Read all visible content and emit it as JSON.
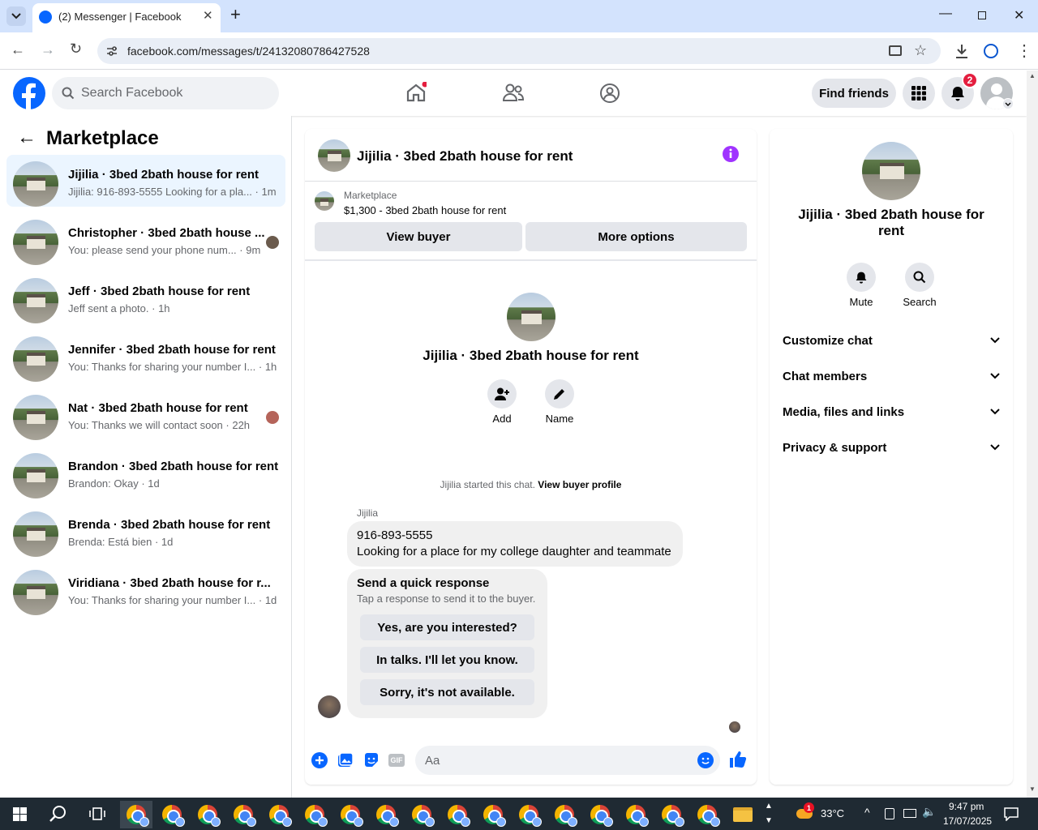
{
  "browser": {
    "tab_title": "(2) Messenger | Facebook",
    "url": "facebook.com/messages/t/24132080786427528"
  },
  "fb_header": {
    "search_placeholder": "Search Facebook",
    "find_friends": "Find friends",
    "notification_count": "2",
    "brand_color": "#0866ff"
  },
  "left_panel": {
    "title": "Marketplace",
    "conversations": [
      {
        "name": "Jijilia · 3bed 2bath house for rent",
        "preview": "Jijilia: 916-893-5555 Looking for a pla...",
        "time": "1m",
        "active": true
      },
      {
        "name": "Christopher · 3bed 2bath house ...",
        "preview": "You: please send your phone num...",
        "time": "9m"
      },
      {
        "name": "Jeff · 3bed 2bath house for rent",
        "preview": "Jeff sent a photo.",
        "time": "1h"
      },
      {
        "name": "Jennifer · 3bed 2bath house for rent",
        "preview": "You: Thanks for sharing your number I...",
        "time": "1h"
      },
      {
        "name": "Nat · 3bed 2bath house for rent",
        "preview": "You: Thanks we will contact soon",
        "time": "22h"
      },
      {
        "name": "Brandon · 3bed 2bath house for rent",
        "preview": "Brandon: Okay",
        "time": "1d"
      },
      {
        "name": "Brenda · 3bed 2bath house for rent",
        "preview": "Brenda: Está bien",
        "time": "1d"
      },
      {
        "name": "Viridiana · 3bed 2bath house for r...",
        "preview": "You: Thanks for sharing your number I...",
        "time": "1d"
      }
    ]
  },
  "chat": {
    "title": "Jijilia · 3bed 2bath house for rent",
    "listing_label": "Marketplace",
    "listing_title": "$1,300 - 3bed 2bath house for rent",
    "view_buyer": "View buyer",
    "more_options": "More options",
    "intro_name": "Jijilia · 3bed 2bath house for rent",
    "add_label": "Add",
    "name_label": "Name",
    "started_text": "Jijilia started this chat.",
    "view_profile": "View buyer profile",
    "sender": "Jijilia",
    "message_line1": "916-893-5555",
    "message_line2": "Looking for a place for my college daughter and teammate",
    "quick_title": "Send a quick response",
    "quick_sub": "Tap a response to send it to the buyer.",
    "quick_responses": [
      "Yes, are you interested?",
      "In talks. I'll let you know.",
      "Sorry, it's not available."
    ],
    "composer_placeholder": "Aa",
    "accent_color": "#0866ff",
    "info_color": "#a033ff"
  },
  "right_panel": {
    "name": "Jijilia · 3bed 2bath house for rent",
    "mute": "Mute",
    "search": "Search",
    "sections": [
      "Customize chat",
      "Chat members",
      "Media, files and links",
      "Privacy & support"
    ]
  },
  "taskbar": {
    "temperature": "33°C",
    "time": "9:47 pm",
    "date": "17/07/2025",
    "weather_badge": "1"
  }
}
